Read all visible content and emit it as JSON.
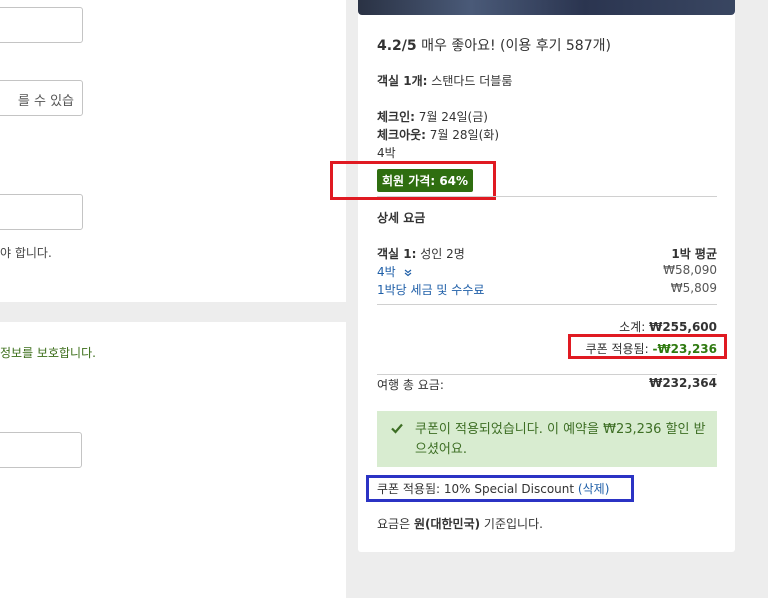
{
  "left": {
    "field_2_text": "를 수 있습",
    "note_1": "야 합니다.",
    "note_2": "정보를 보호합니다."
  },
  "summary": {
    "rating_score": "4.2/5",
    "rating_text": "매우 좋아요! (이용 후기 587개)",
    "room_label": "객실 1개:",
    "room_value": "스탠다드 더블룸",
    "checkin_label": "체크인:",
    "checkin_value": "7월 24일(금)",
    "checkout_label": "체크아웃:",
    "checkout_value": "7월 28일(화)",
    "nights": "4박",
    "member_price": "회원 가격: 64%"
  },
  "details": {
    "title": "상세 요금",
    "room_label": "객실 1:",
    "room_value": "성인 2명",
    "avg_label": "1박 평균",
    "nights_link": "4박",
    "nightly_price": "₩58,090",
    "tax_link": "1박당 세금 및 수수료",
    "tax_price": "₩5,809",
    "subtotal_label": "소계:",
    "subtotal_value": "₩255,600",
    "coupon_applied_label": "쿠폰 적용됨:",
    "coupon_applied_value": "-₩23,236",
    "total_label": "여행 총 요금:",
    "total_value": "₩232,364",
    "coupon_message": "쿠폰이 적용되었습니다. 이 예약을 ₩23,236 할인 받으셨어요.",
    "coupon_line_label": "쿠폰 적용됨: 10% Special Discount",
    "coupon_remove_open": "(",
    "coupon_remove": "삭제",
    "coupon_remove_close": ")",
    "currency_prefix": "요금은 ",
    "currency_bold": "원(대한민국)",
    "currency_suffix": " 기준입니다."
  },
  "colors": {
    "member_badge": "#2f6e10",
    "link": "#1f5fa8",
    "success_bg": "#d8ecd0",
    "highlight_red": "#e01a22",
    "highlight_blue": "#2b33c4"
  }
}
